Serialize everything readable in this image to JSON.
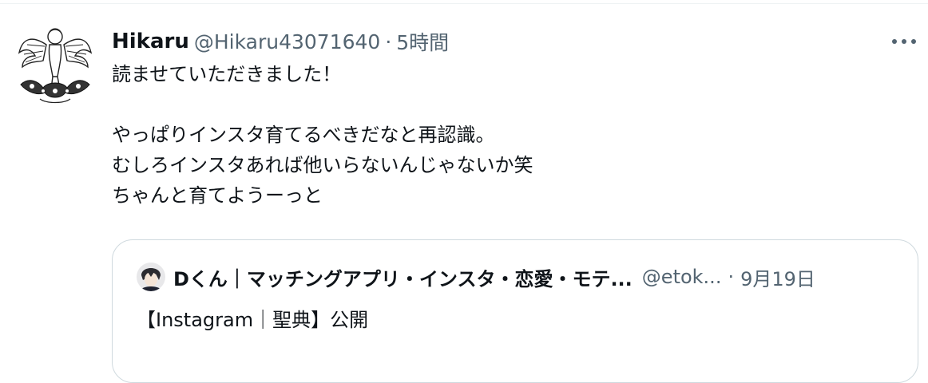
{
  "tweet": {
    "display_name": "Hikaru",
    "handle": "@Hikaru43071640",
    "separator": "·",
    "time": "5時間",
    "lines": [
      "読ませていただきました！",
      "",
      "やっぱりインスタ育てるべきだなと再認識。",
      "むしろインスタあれば他いらないんじゃないか笑",
      "ちゃんと育てようーっと"
    ],
    "more_icon": "more-dots-icon"
  },
  "quote": {
    "display_name": "Dくん｜マッチングアプリ・インスタ・恋愛・モテ...",
    "handle": "@etok...",
    "separator": "·",
    "time": "9月19日",
    "text": "【Instagram｜聖典】公開"
  },
  "colors": {
    "text_primary": "#0f1419",
    "text_secondary": "#536471",
    "border": "#cfd9de"
  }
}
